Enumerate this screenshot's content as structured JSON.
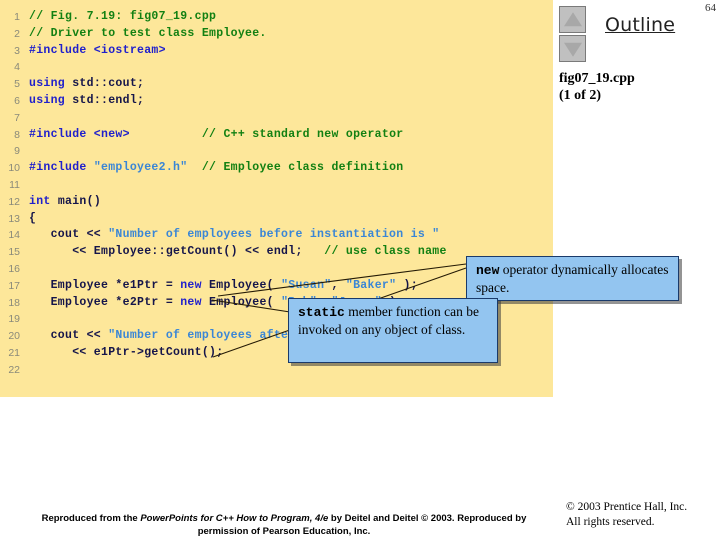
{
  "colors": {
    "code_panel_bg": "#fde79a",
    "comment": "#128012",
    "keyword": "#2020cc",
    "string": "#3a86d6",
    "plain": "#15154a",
    "line_number": "#8a8a7a",
    "callout_bg": "#93c5f0",
    "callout_border": "#1a3a6a",
    "nav_button_bg": "#c0c0c0"
  },
  "code": {
    "language": "cpp",
    "lines": [
      {
        "n": "1",
        "tokens": [
          {
            "t": "comment",
            "s": "// Fig. 7.19: fig07_19.cpp"
          }
        ]
      },
      {
        "n": "2",
        "tokens": [
          {
            "t": "comment",
            "s": "// Driver to test class Employee."
          }
        ]
      },
      {
        "n": "3",
        "tokens": [
          {
            "t": "pre",
            "s": "#include <iostream>"
          }
        ]
      },
      {
        "n": "4",
        "tokens": []
      },
      {
        "n": "5",
        "tokens": [
          {
            "t": "keyword",
            "s": "using "
          },
          {
            "t": "plain",
            "s": "std::cout;"
          }
        ]
      },
      {
        "n": "6",
        "tokens": [
          {
            "t": "keyword",
            "s": "using "
          },
          {
            "t": "plain",
            "s": "std::endl;"
          }
        ]
      },
      {
        "n": "7",
        "tokens": []
      },
      {
        "n": "8",
        "tokens": [
          {
            "t": "pre",
            "s": "#include <new>"
          },
          {
            "t": "plain",
            "s": "          "
          },
          {
            "t": "comment",
            "s": "// C++ standard new operator"
          }
        ]
      },
      {
        "n": "9",
        "tokens": []
      },
      {
        "n": "10",
        "tokens": [
          {
            "t": "pre",
            "s": "#include "
          },
          {
            "t": "string",
            "s": "\"employee2.h\""
          },
          {
            "t": "plain",
            "s": "  "
          },
          {
            "t": "comment",
            "s": "// Employee class definition"
          }
        ]
      },
      {
        "n": "11",
        "tokens": []
      },
      {
        "n": "12",
        "tokens": [
          {
            "t": "keyword",
            "s": "int "
          },
          {
            "t": "plain",
            "s": "main()"
          }
        ]
      },
      {
        "n": "13",
        "tokens": [
          {
            "t": "plain",
            "s": "{"
          }
        ]
      },
      {
        "n": "14",
        "tokens": [
          {
            "t": "plain",
            "s": "   cout << "
          },
          {
            "t": "string",
            "s": "\"Number of employees before instantiation is \""
          }
        ]
      },
      {
        "n": "15",
        "tokens": [
          {
            "t": "plain",
            "s": "      << Employee::getCount() << endl;   "
          },
          {
            "t": "comment",
            "s": "// use class name"
          }
        ]
      },
      {
        "n": "16",
        "tokens": []
      },
      {
        "n": "17",
        "tokens": [
          {
            "t": "plain",
            "s": "   Employee *e1Ptr = "
          },
          {
            "t": "keyword",
            "s": "new "
          },
          {
            "t": "plain",
            "s": "Employee( "
          },
          {
            "t": "string",
            "s": "\"Susan\""
          },
          {
            "t": "plain",
            "s": ", "
          },
          {
            "t": "string",
            "s": "\"Baker\""
          },
          {
            "t": "plain",
            "s": " );"
          }
        ]
      },
      {
        "n": "18",
        "tokens": [
          {
            "t": "plain",
            "s": "   Employee *e2Ptr = "
          },
          {
            "t": "keyword",
            "s": "new "
          },
          {
            "t": "plain",
            "s": "Employee( "
          },
          {
            "t": "string",
            "s": "\"Bob\""
          },
          {
            "t": "plain",
            "s": ", "
          },
          {
            "t": "string",
            "s": "\"Jones\""
          },
          {
            "t": "plain",
            "s": " );"
          }
        ]
      },
      {
        "n": "19",
        "tokens": []
      },
      {
        "n": "20",
        "tokens": [
          {
            "t": "plain",
            "s": "   cout << "
          },
          {
            "t": "string",
            "s": "\"Number of employees after instantiation is \""
          }
        ]
      },
      {
        "n": "21",
        "tokens": [
          {
            "t": "plain",
            "s": "      << e1Ptr->getCount();"
          }
        ]
      },
      {
        "n": "22",
        "tokens": []
      }
    ]
  },
  "callouts": [
    {
      "id": "new-operator",
      "lead": "new",
      "text": " operator dynamically allocates space."
    },
    {
      "id": "static-member",
      "lead": "static",
      "text": " member function can be invoked on any object of class."
    }
  ],
  "outline": {
    "title": "Outline",
    "page_number": "64",
    "file_name": "fig07_19.cpp",
    "file_part": "(1 of 2)",
    "nav_up_icon": "triangle-up-icon",
    "nav_down_icon": "triangle-down-icon"
  },
  "footer": {
    "credit_prefix": "Reproduced from the ",
    "credit_italic": "PowerPoints for C++ How to Program, 4/e",
    "credit_suffix": " by Deitel and Deitel © 2003. Reproduced by permission of Pearson Education, Inc.",
    "copyright_line1": "© 2003 Prentice Hall, Inc.",
    "copyright_line2": "All rights reserved."
  }
}
